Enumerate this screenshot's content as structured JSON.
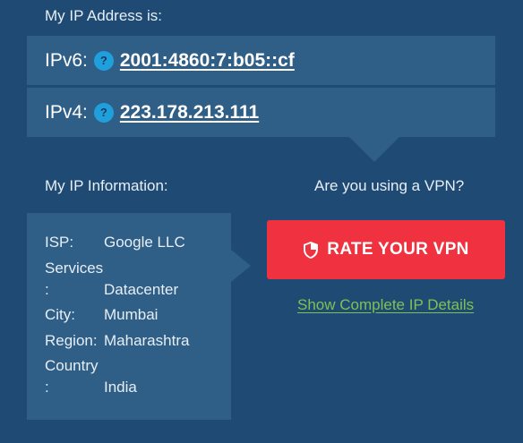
{
  "ip_section": {
    "heading": "My IP Address is:",
    "ipv6": {
      "label": "IPv6:",
      "help": "?",
      "value": "2001:4860:7:b05::cf"
    },
    "ipv4": {
      "label": "IPv4:",
      "help": "?",
      "value": "223.178.213.111"
    }
  },
  "info_section": {
    "heading": "My IP Information:",
    "rows": [
      {
        "label": "ISP:",
        "value": "Google LLC"
      },
      {
        "label_line1": "Services",
        "label_line2": ":",
        "value": "Datacenter"
      },
      {
        "label": "City:",
        "value": "Mumbai"
      },
      {
        "label": "Region:",
        "value": "Maharashtra"
      },
      {
        "label_line1": "Country",
        "label_line2": ":",
        "value": "India"
      }
    ]
  },
  "vpn_section": {
    "question": "Are you using a VPN?",
    "button_label": "RATE YOUR VPN",
    "details_link": "Show Complete IP Details"
  },
  "colors": {
    "background": "#1f4a73",
    "panel": "#2f5e86",
    "button": "#f0313f",
    "link": "#7fc156",
    "help_icon": "#1fa0dc"
  },
  "icons": {
    "help": "question-circle-icon",
    "shield": "shield-icon"
  }
}
